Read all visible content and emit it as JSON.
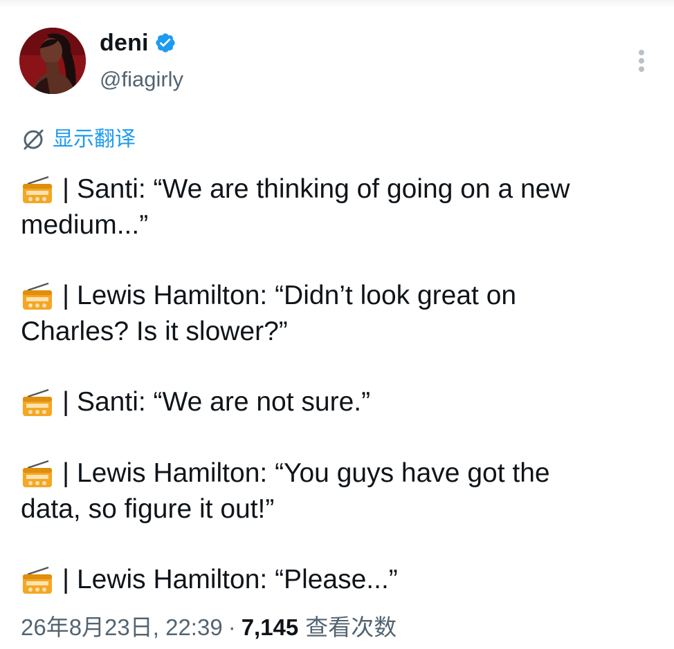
{
  "author": {
    "display_name": "deni",
    "handle": "@fiagirly",
    "verified": true
  },
  "translate_label": "显示翻译",
  "tweet": {
    "lines": [
      {
        "first": "| Santi: “We are thinking of going on a new",
        "second": "medium...”"
      },
      {
        "first": "| Lewis Hamilton: “Didn’t look great on",
        "second": "Charles? Is it slower?”"
      },
      {
        "first": "| Santi: “We are not sure.”",
        "second": ""
      },
      {
        "first": "| Lewis Hamilton: “You guys have got the",
        "second": "data, so figure it out!”"
      },
      {
        "first": "| Lewis Hamilton: “Please...”",
        "second": ""
      }
    ]
  },
  "meta": {
    "timestamp": "26年8月23日, 22:39",
    "separator": "·",
    "views_count": "7,145",
    "views_label": "查看次数"
  },
  "colors": {
    "accent": "#1d9bf0",
    "text": "#0f1419",
    "secondary": "#536471",
    "radio": "#f5a623"
  },
  "icons": [
    "verified-badge-icon",
    "more-options-icon",
    "translate-icon",
    "radio-icon"
  ]
}
